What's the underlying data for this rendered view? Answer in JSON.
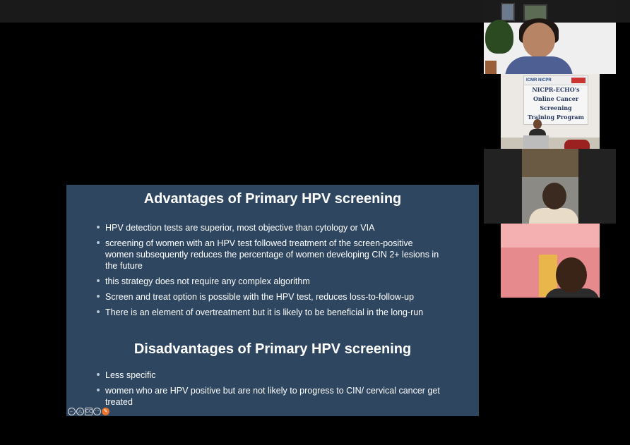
{
  "slide": {
    "advantages": {
      "title": "Advantages of Primary HPV screening",
      "items": [
        "HPV detection tests are superior, most objective than cytology or VIA",
        "screening of women with an HPV test followed treatment of the screen-positive women subsequently reduces the percentage of women developing CIN 2+ lesions in the future",
        "this strategy does not require any complex algorithm",
        "Screen and treat option is possible with the HPV test, reduces loss-to-follow-up",
        "There is an element of overtreatment but it is likely to be beneficial in the long-run"
      ]
    },
    "disadvantages": {
      "title": "Disadvantages of Primary HPV screening",
      "items": [
        "Less specific",
        "women who are HPV positive but are not likely to progress to CIN/ cervical cancer get treated"
      ]
    },
    "controls": {
      "cc_label": "CC",
      "icons": [
        "back-arrow-icon",
        "pointer-icon",
        "cc-icon",
        "menu-icon",
        "pen-icon"
      ]
    }
  },
  "video_tiles": {
    "tile_2_banner": {
      "logos": "ICMR NICPR",
      "lines": [
        "NICPR-ECHO's",
        "Online Cancer Screening",
        "Training Program"
      ]
    }
  },
  "colors": {
    "slide_background": "#2e4660",
    "page_background": "#000000",
    "accent_orange": "#e8742a"
  }
}
